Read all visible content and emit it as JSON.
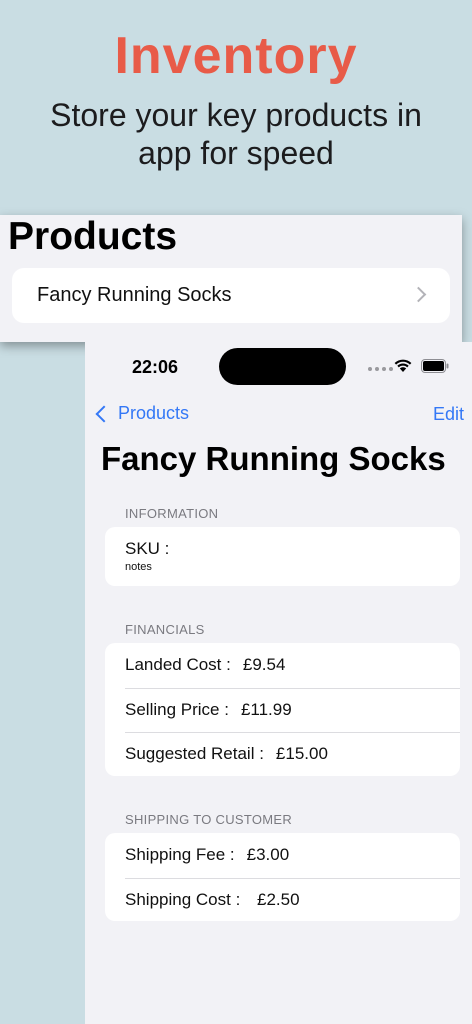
{
  "hero": {
    "title": "Inventory",
    "subtitle": "Store your key products in app for speed"
  },
  "products_panel": {
    "heading": "Products",
    "items": [
      {
        "label": "Fancy Running Socks"
      }
    ]
  },
  "phone": {
    "status": {
      "time": "22:06"
    },
    "nav": {
      "back_label": "Products",
      "edit_label": "Edit"
    },
    "title": "Fancy Running Socks",
    "sections": {
      "information": {
        "header": "INFORMATION",
        "sku_label": "SKU :",
        "notes": "notes"
      },
      "financials": {
        "header": "FINANCIALS",
        "rows": [
          {
            "label": "Landed Cost :",
            "value": "£9.54"
          },
          {
            "label": "Selling Price :",
            "value": "£11.99"
          },
          {
            "label": "Suggested Retail :",
            "value": "£15.00"
          }
        ]
      },
      "shipping": {
        "header": "SHIPPING TO CUSTOMER",
        "rows": [
          {
            "label": "Shipping Fee :",
            "value": "£3.00"
          },
          {
            "label": "Shipping Cost :",
            "value": " £2.50"
          }
        ]
      }
    }
  },
  "colors": {
    "background": "#c9dde3",
    "accent_title": "#e85b48",
    "ios_blue": "#3478f6"
  },
  "icons": [
    "chevron-right-icon",
    "chevron-left-icon",
    "wifi-icon",
    "battery-icon"
  ]
}
